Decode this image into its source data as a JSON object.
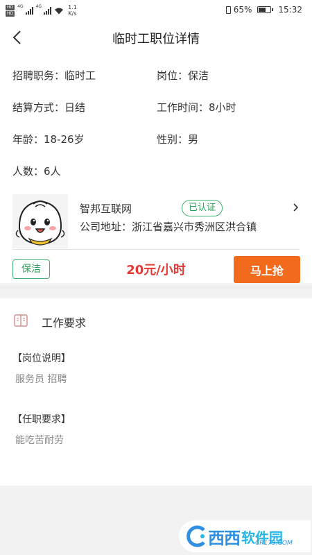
{
  "status_bar": {
    "hd1": "HD",
    "hd2": "HD",
    "net1": "4G",
    "net2": "4G",
    "speed_value": "1.1",
    "speed_unit": "K/s",
    "battery_percent": "65%",
    "battery_level": 0.65,
    "time": "15:32"
  },
  "header": {
    "title": "临时工职位详情"
  },
  "job": {
    "position": "招聘职务：临时工",
    "post": "岗位：保洁",
    "settlement": "结算方式：日结",
    "hours": "工作时间：8小时",
    "age": "年龄：18-26岁",
    "gender": "性别：男",
    "headcount": "人数：6人"
  },
  "company": {
    "name": "智邦互联网",
    "verified": "已认证",
    "address": "公司地址：浙江省嘉兴市秀洲区洪合镇"
  },
  "summary": {
    "tag": "保洁",
    "salary": "20元/小时",
    "apply_label": "马上抢"
  },
  "requirements": {
    "title": "工作要求",
    "desc_heading": "【岗位说明】",
    "desc_text": "服务员 招聘",
    "qual_heading": "【任职要求】",
    "qual_text": "能吃苦耐劳"
  },
  "watermark": {
    "text": "西西",
    "text2": "软件园",
    "sub": "CR173.COM"
  },
  "colors": {
    "accent_orange": "#f26b1d",
    "salary_red": "#e53935",
    "tag_green": "#3cb371"
  }
}
